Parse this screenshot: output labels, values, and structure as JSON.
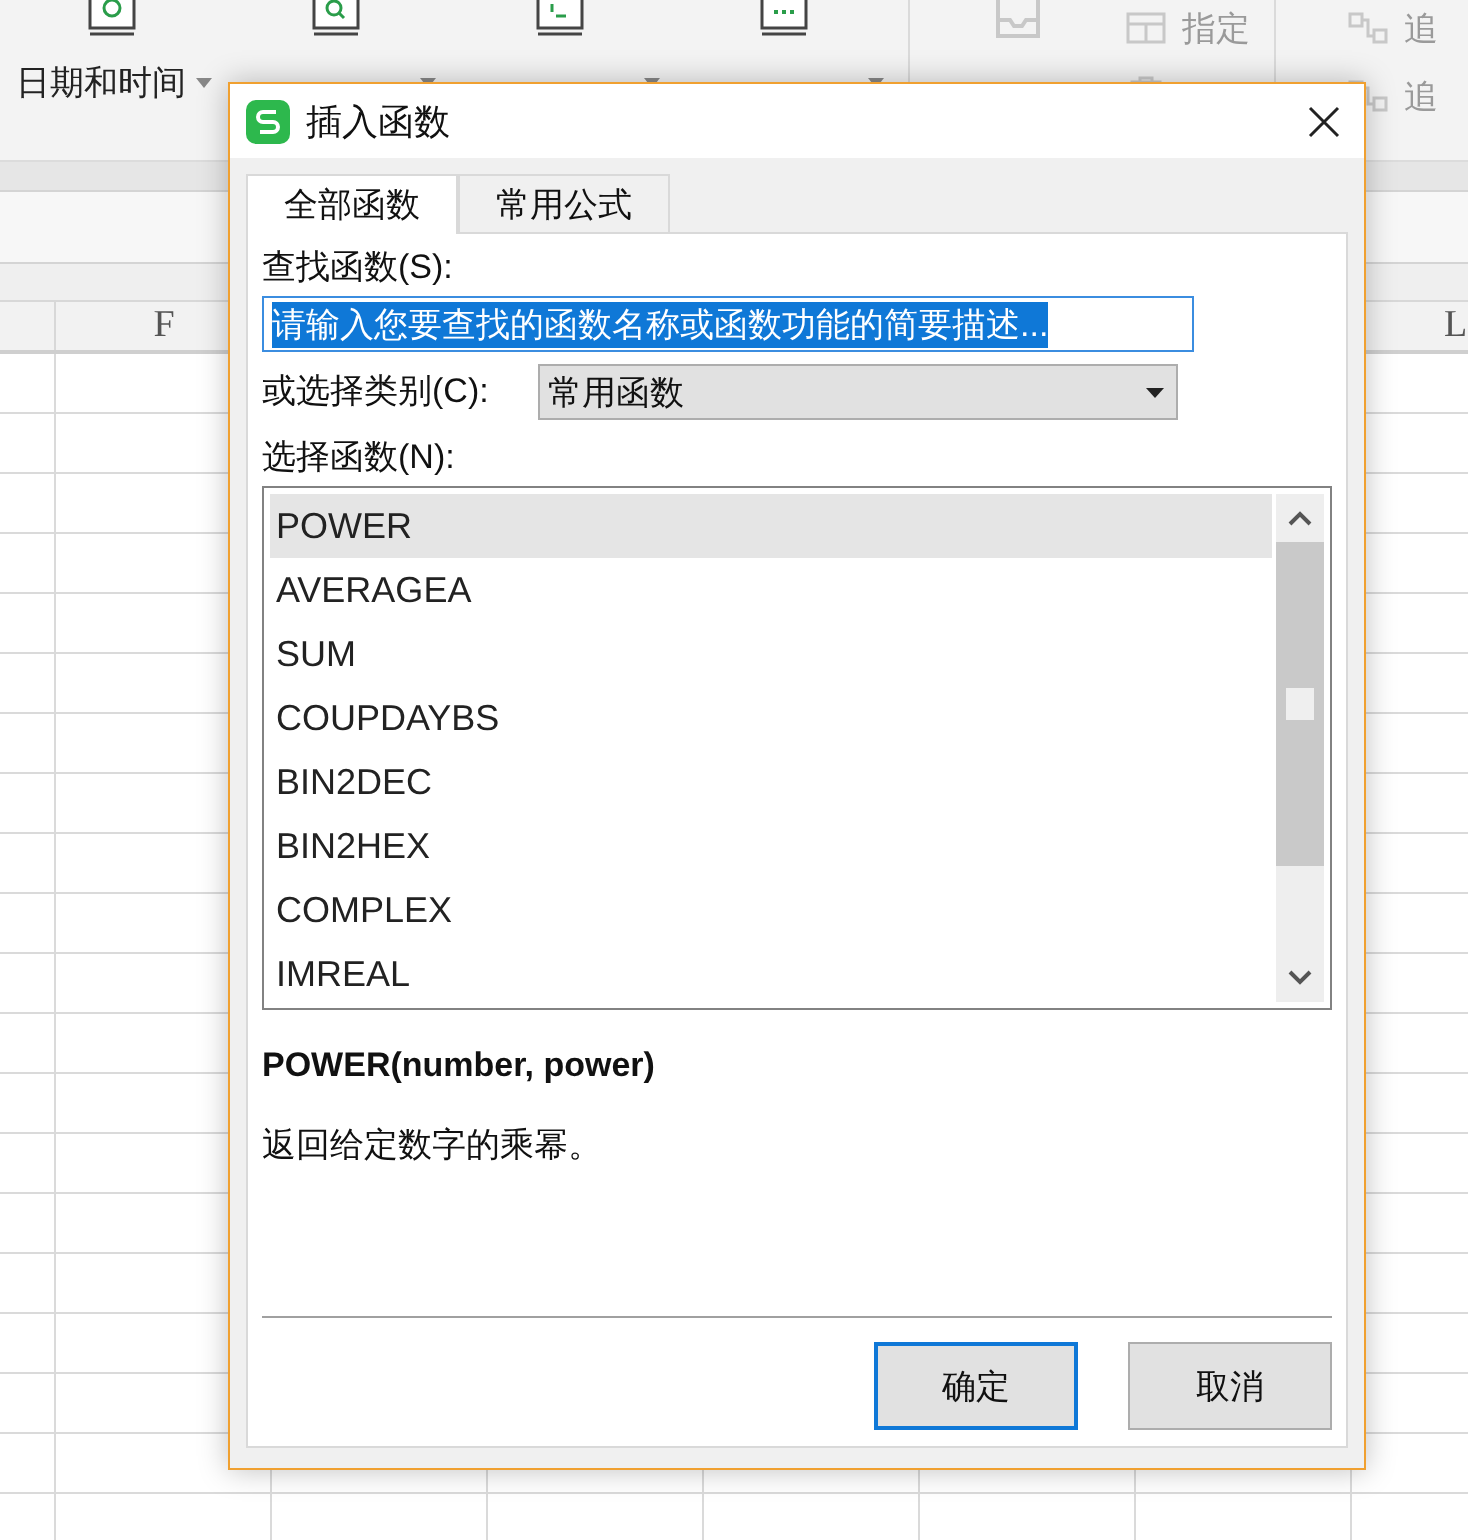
{
  "ribbon": {
    "groups": [
      {
        "label": "日期和时间",
        "dropdown": true,
        "disabled": false
      },
      {
        "dropdown": true,
        "disabled": false
      },
      {
        "dropdown": true,
        "disabled": false
      },
      {
        "dropdown": true,
        "disabled": false
      },
      {
        "dropdown": false,
        "disabled": true
      }
    ],
    "small_items": [
      {
        "label": "指定",
        "disabled": true
      }
    ],
    "trace_items": [
      {
        "label": "追",
        "disabled": true
      },
      {
        "label": "追",
        "disabled": true
      }
    ]
  },
  "sheet": {
    "columns": [
      "",
      "F",
      "",
      "",
      "",
      "",
      "",
      "L"
    ]
  },
  "dialog": {
    "title": "插入函数",
    "tabs": [
      {
        "label": "全部函数",
        "selected": true
      },
      {
        "label": "常用公式",
        "selected": false
      }
    ],
    "search": {
      "label": "查找函数(S):",
      "value": "请输入您要查找的函数名称或函数功能的简要描述...",
      "text_selected": true
    },
    "category": {
      "label": "或选择类别(C):",
      "value": "常用函数"
    },
    "functions": {
      "label": "选择函数(N):",
      "items": [
        {
          "name": "POWER",
          "selected": true
        },
        {
          "name": "AVERAGEA",
          "selected": false
        },
        {
          "name": "SUM",
          "selected": false
        },
        {
          "name": "COUPDAYBS",
          "selected": false
        },
        {
          "name": "BIN2DEC",
          "selected": false
        },
        {
          "name": "BIN2HEX",
          "selected": false
        },
        {
          "name": "COMPLEX",
          "selected": false
        },
        {
          "name": "IMREAL",
          "selected": false
        }
      ]
    },
    "signature": "POWER(number, power)",
    "description": "返回给定数字的乘幂。",
    "buttons": [
      {
        "label": "确定",
        "default": true
      },
      {
        "label": "取消",
        "default": false
      }
    ]
  }
}
